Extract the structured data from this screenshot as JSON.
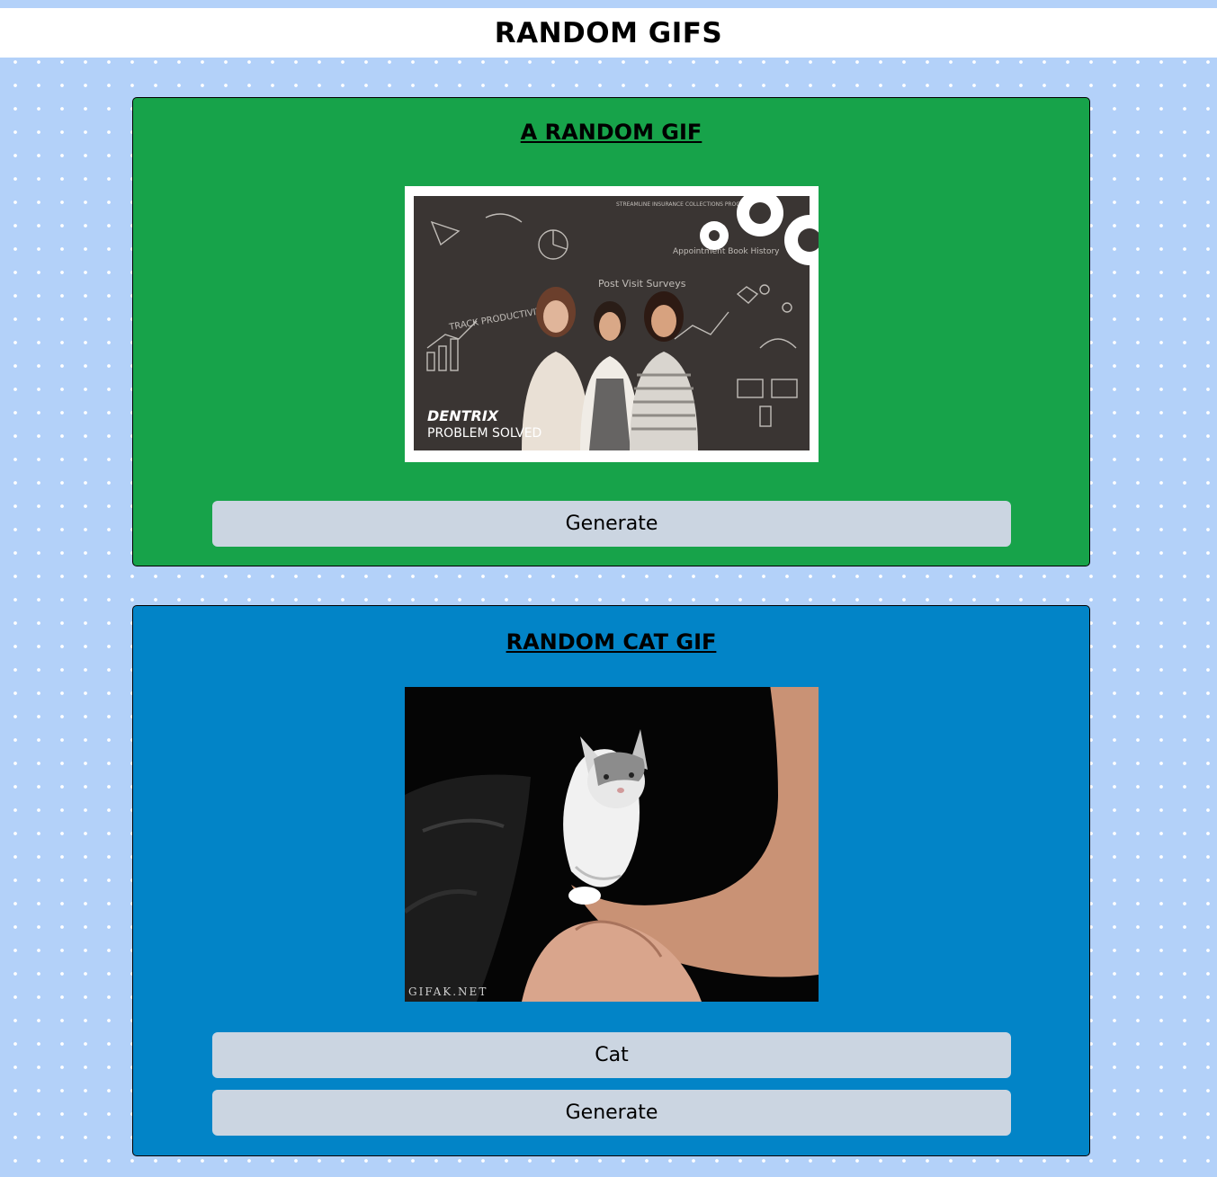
{
  "header": {
    "title": "RANDOM GIFS"
  },
  "random_gif_card": {
    "title": "A RANDOM GIF",
    "gif": {
      "overlay_brand": "DENTRIX",
      "overlay_tagline": "PROBLEM SOLVED",
      "chalk_texts": [
        "Post Visit Surveys",
        "Appointment Book History",
        "TRACK PRODUCTIVITY",
        "STREAMLINE INSURANCE COLLECTIONS PROCESS"
      ]
    },
    "generate_label": "Generate",
    "background_color": "#17a34a"
  },
  "cat_gif_card": {
    "title": "RANDOM CAT GIF",
    "gif": {
      "watermark": "GIFAK.NET"
    },
    "tag_input_value": "Cat",
    "generate_label": "Generate",
    "background_color": "#0284c7"
  },
  "colors": {
    "page_background": "#b3d1f9",
    "button_background": "#cbd5e1"
  }
}
